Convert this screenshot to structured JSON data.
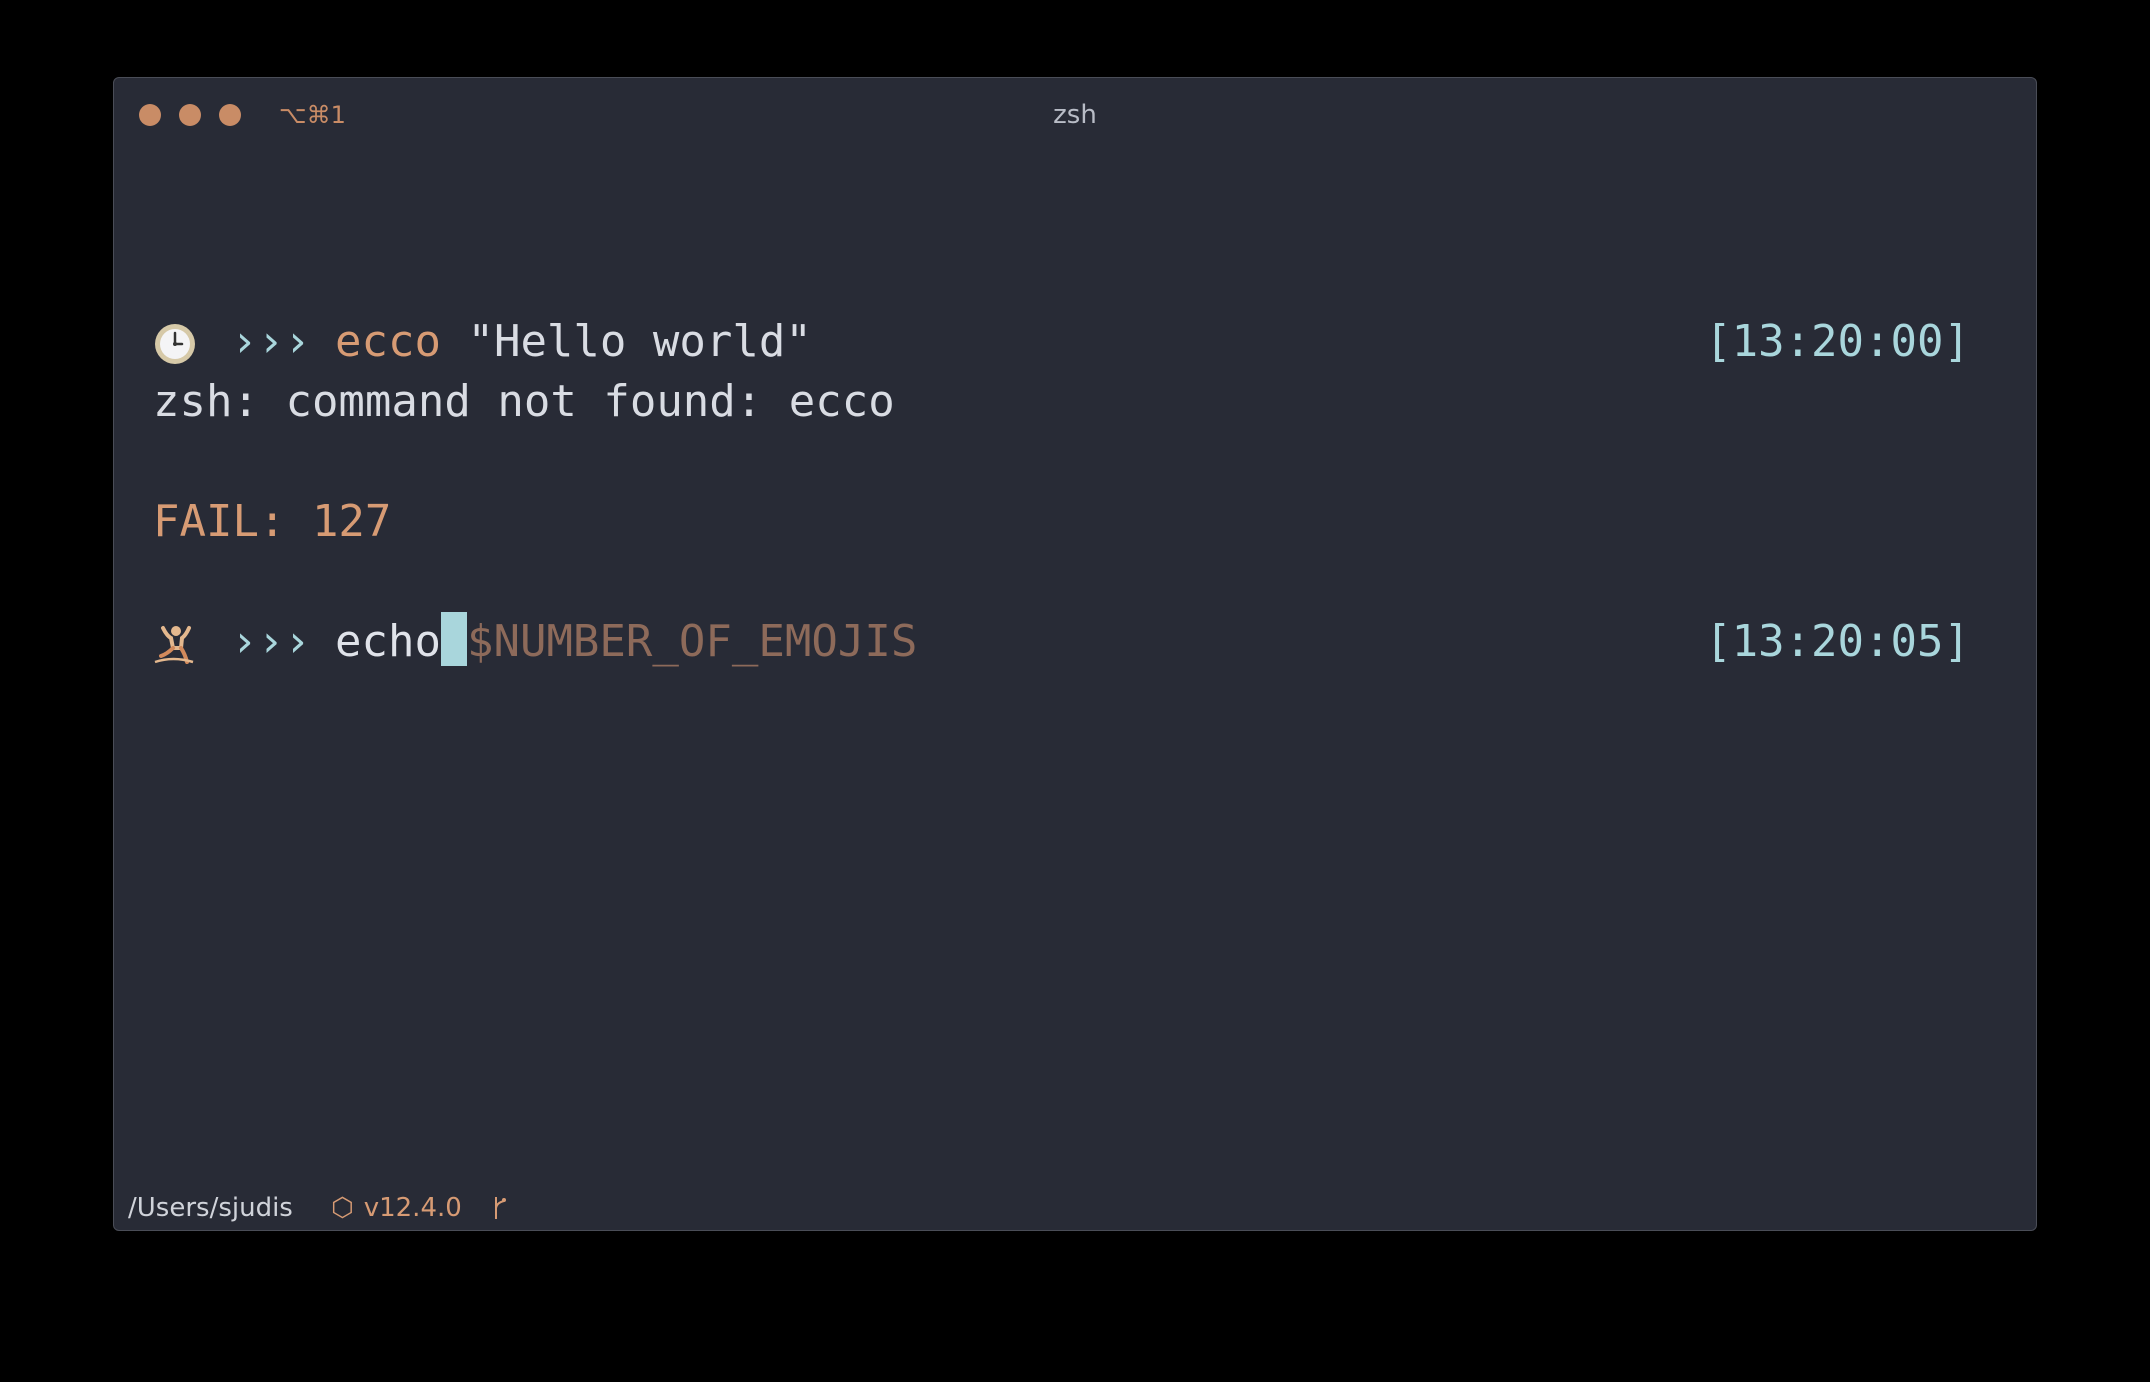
{
  "window": {
    "shortcut": "⌥⌘1",
    "title": "zsh"
  },
  "terminal": {
    "lines": [
      {
        "icon": "clock-emoji-icon",
        "arrows": "›››",
        "command": "ecco",
        "args": " \"Hello world\"",
        "time": "[13:20:00]"
      },
      {
        "output": "zsh: command not found: ecco"
      },
      {
        "fail": "FAIL: 127"
      },
      {
        "icon": "person-emoji-icon",
        "arrows": "›››",
        "command": "echo",
        "suggestion": "$NUMBER_OF_EMOJIS",
        "time": "[13:20:05]"
      }
    ]
  },
  "statusbar": {
    "path": "/Users/sjudis",
    "node_icon": "⬡",
    "node_version": "v12.4.0",
    "branch_icon": "git-branch-icon"
  },
  "colors": {
    "background": "#282b36",
    "accent_orange": "#d79b74",
    "accent_cyan": "#a9d6dc"
  }
}
